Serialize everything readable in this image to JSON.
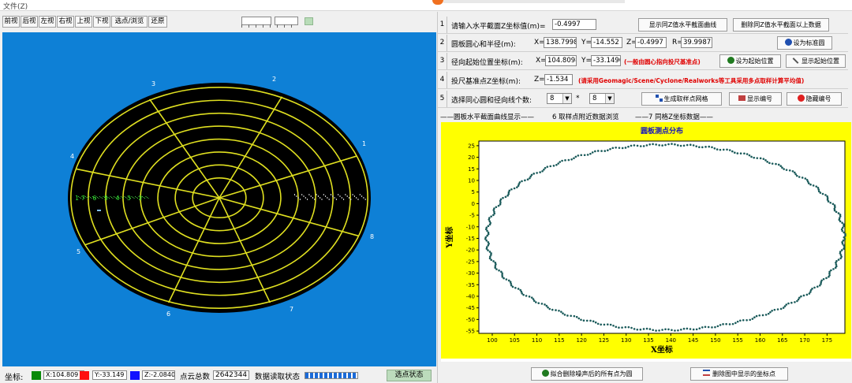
{
  "menu": {
    "file": "文件(Z)"
  },
  "view_toolbar": [
    "前视",
    "后视",
    "左视",
    "右视",
    "上视",
    "下视",
    "选点/浏览",
    "还原"
  ],
  "viewport": {
    "radial_labels": [
      "1",
      "2",
      "3",
      "4",
      "5",
      "6",
      "7",
      "8"
    ],
    "ring_labels": [
      "7",
      "6",
      "5",
      "4",
      "3",
      "2"
    ],
    "ring_label_prefix": "1"
  },
  "status": {
    "coord_label": "坐标:",
    "x": "X:104.809",
    "y": "Y:-33.149",
    "z": "Z:-2.0840",
    "total_label": "点云总数",
    "total": "2642344",
    "read_status": "数据读取状态",
    "select_status": "选点状态",
    "colors": {
      "x": "#0a8a0a",
      "y": "#ff1010",
      "z": "#1010ff"
    }
  },
  "rows": {
    "r1": {
      "num": "1",
      "label": "请输入水平截面Z坐标值(m)=",
      "value": "-0.4997",
      "btn1": "显示同Z值水平截面曲线",
      "btn2": "删除同Z值水平截面以上数据"
    },
    "r2": {
      "num": "2",
      "label": "圆板圆心和半径(m):",
      "x_lbl": "X=",
      "x": "138.7998",
      "y_lbl": "Y=",
      "y": "-14.552",
      "z_lbl": "Z=",
      "z": "-0.4997",
      "r_lbl": "R=",
      "r": "39.9987",
      "btn": "设为标准圆"
    },
    "r3": {
      "num": "3",
      "label": "径向起始位置坐标(m):",
      "x_lbl": "X=",
      "x": "104.8098",
      "y_lbl": "Y=",
      "y": "-33.1496",
      "note": "(一般由圆心指向投尺基准点)",
      "btn1": "设为起始位置",
      "btn2": "显示起始位置"
    },
    "r4": {
      "num": "4",
      "label": "投尺基准点Z坐标(m):",
      "z_lbl": "Z=",
      "z": "-1.534",
      "note": "(请采用Geomagic/Scene/Cyclone/Realworks等工具采用多点取样计算平均值)"
    },
    "r5": {
      "num": "5",
      "label": "选择同心圆和径向线个数:",
      "sel1": "8",
      "times": "*",
      "sel2": "8",
      "btn1": "生成取样点网格",
      "btn2": "显示编号",
      "btn3": "隐藏编号"
    }
  },
  "tabs": [
    "——圆板水平截面曲线显示——",
    "6 取样点附近数据浏览",
    "——7 同格Z坐标数据——"
  ],
  "chart_data": {
    "type": "scatter",
    "title": "圆板测点分布",
    "xlabel": "X坐标",
    "ylabel": "Y坐标",
    "xlim": [
      97,
      179
    ],
    "ylim": [
      -56,
      27
    ],
    "x_ticks": [
      100,
      105,
      110,
      115,
      120,
      125,
      130,
      135,
      140,
      145,
      150,
      155,
      160,
      165,
      170,
      175
    ],
    "y_ticks": [
      -55,
      -50,
      -45,
      -40,
      -35,
      -30,
      -25,
      -20,
      -15,
      -10,
      -5,
      0,
      5,
      10,
      15,
      20,
      25
    ],
    "center": [
      138.8,
      -14.55
    ],
    "radius_x": 39.9987,
    "radius_y": 39.9987,
    "plot_bg": "#ffff00",
    "point_color": "#1a5a5a"
  },
  "bottom": {
    "btn1": "拟合删除噪声后的所有点为圆",
    "btn2": "删除图中显示的坐标点"
  }
}
